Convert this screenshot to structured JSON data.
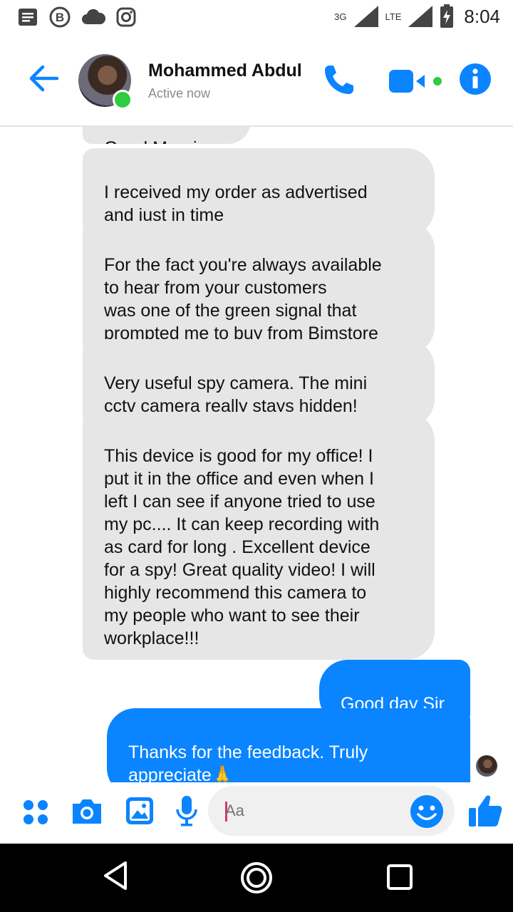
{
  "status_bar": {
    "time": "8:04",
    "network_3g": "3G",
    "network_lte": "LTE",
    "icons": [
      "notes-icon",
      "b-badge-icon",
      "cloud-icon",
      "instagram-icon",
      "signal-icon",
      "battery-charging-icon"
    ]
  },
  "header": {
    "contact_name": "Mohammed Abdul",
    "contact_status": "Active now",
    "accent_color": "#0a84ff",
    "online_color": "#2ecc40"
  },
  "messages": {
    "partial_top": "Good Morning",
    "incoming": [
      "I received my order as advertised\nand just in time",
      "For the fact you're always available\nto hear from your customers\nwas one of the green signal that\nprompted me to buy from Bimstore",
      "Very useful spy camera. The mini\ncctv camera really stays hidden!",
      "This device is good for my office! I\nput it in the office and even when I\nleft I can see if anyone tried to use\nmy pc.... It can keep recording with\nas card for long . Excellent device\nfor a spy! Great quality video! I will\nhighly recommend this camera to\nmy people who want to see their\nworkplace!!!"
    ],
    "outgoing": [
      "Good day Sir",
      "Thanks for the feedback. Truly\nappreciate🙏"
    ]
  },
  "composer": {
    "placeholder": "Aa"
  },
  "nav_bar": {
    "icons": [
      "back-triangle-icon",
      "home-circle-icon",
      "recents-square-icon"
    ]
  }
}
